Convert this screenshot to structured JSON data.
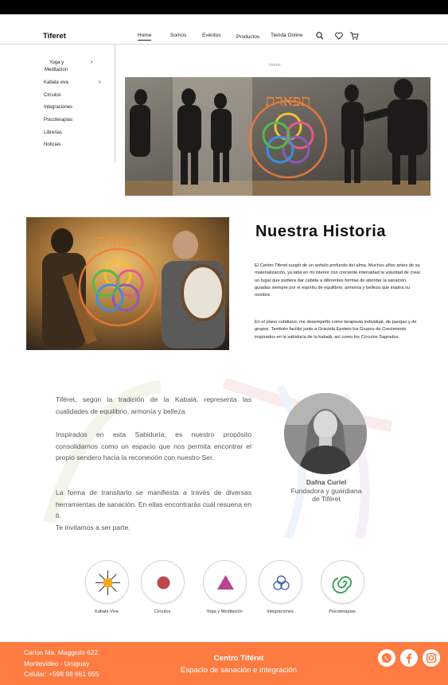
{
  "header": {
    "brand": "Tiferet",
    "nav": [
      "Home",
      "Somos",
      "Eventos",
      "Productos",
      "Tienda Online"
    ],
    "icons": [
      "search-icon",
      "heart-icon",
      "cart-icon"
    ]
  },
  "sidebar": {
    "items": [
      {
        "label": "Yoga y",
        "label2": "Meditacion",
        "has_submenu": true
      },
      {
        "label": "Kabala viva",
        "has_submenu": true
      },
      {
        "label": "Circulos"
      },
      {
        "label": "Integraciones"
      },
      {
        "label": "Psicoterapias"
      },
      {
        "label": "Librerias"
      },
      {
        "label": "Noticias"
      }
    ]
  },
  "breadcrumb": "Home",
  "hero": {
    "logo_text": "תפארת"
  },
  "story": {
    "title": "Nuestra Historia",
    "paragraphs": [
      "El Centro Tiferet surgió de un anhelo profundo del alma. Muchos años antes de su materialización, ya latía en mi interior con creciente intensidad la voluntad de crear un lugar que pudiera dar cabida a diferentes formas de abordar la sanación, guiadas siempre por el espíritu de equilibrio, armonía y belleza que inspira su nombre.",
      "En el plano cotidiano, me desempeño como terapeuta individual, de parejas y de grupos. También facilito junto a Graciela Epstein los Grupos de Crecimiento inspirados en la sabiduría de la kabalá, así como los Círculos Sagrados."
    ]
  },
  "quote": {
    "paragraphs": [
      "Tiféret, según la tradición de la Kabalá, representa las cualidades de equilibrio, armonía y belleza.",
      "Inspirados en esta Sabiduría, es nuestro propósito consolidarnos como un espacio que nos permita encontrar el propio sendero hacia la reconexión con nuestro Ser.",
      "La forma de transitarlo se manifiesta a través de diversas herramientas de sanación. En ellas encontrarás cuál resuena en ti.",
      "Te invitamos a ser parte."
    ]
  },
  "person": {
    "name": "Dafna Curiel",
    "role_line1": "Fundadora y guardiana",
    "role_line2": "de Tiféret"
  },
  "services": [
    {
      "label": "Kabalá Viva",
      "icon": "sun-icon",
      "color": "#f4a91d"
    },
    {
      "label": "Círculos",
      "icon": "circle-icon",
      "color": "#c2464a"
    },
    {
      "label": "Yoga y Meditación",
      "icon": "triangle-icon",
      "color": "#b6448f"
    },
    {
      "label": "Integraciones",
      "icon": "rings-icon",
      "color": "#3d58a3"
    },
    {
      "label": "Psicoterapias",
      "icon": "spiral-icon",
      "color": "#2f9e4f"
    }
  ],
  "footer": {
    "address_line1": "Carlos Ma. Maggiolo 622",
    "address_line2": "Montevideo - Uruguay",
    "phone": "Celular: +598 98 661 655",
    "title": "Centro Tiféret",
    "subtitle": "Espacio de sanación e integración",
    "social": [
      "whatsapp-icon",
      "facebook-icon",
      "instagram-icon"
    ],
    "color": "#fe7b42"
  }
}
